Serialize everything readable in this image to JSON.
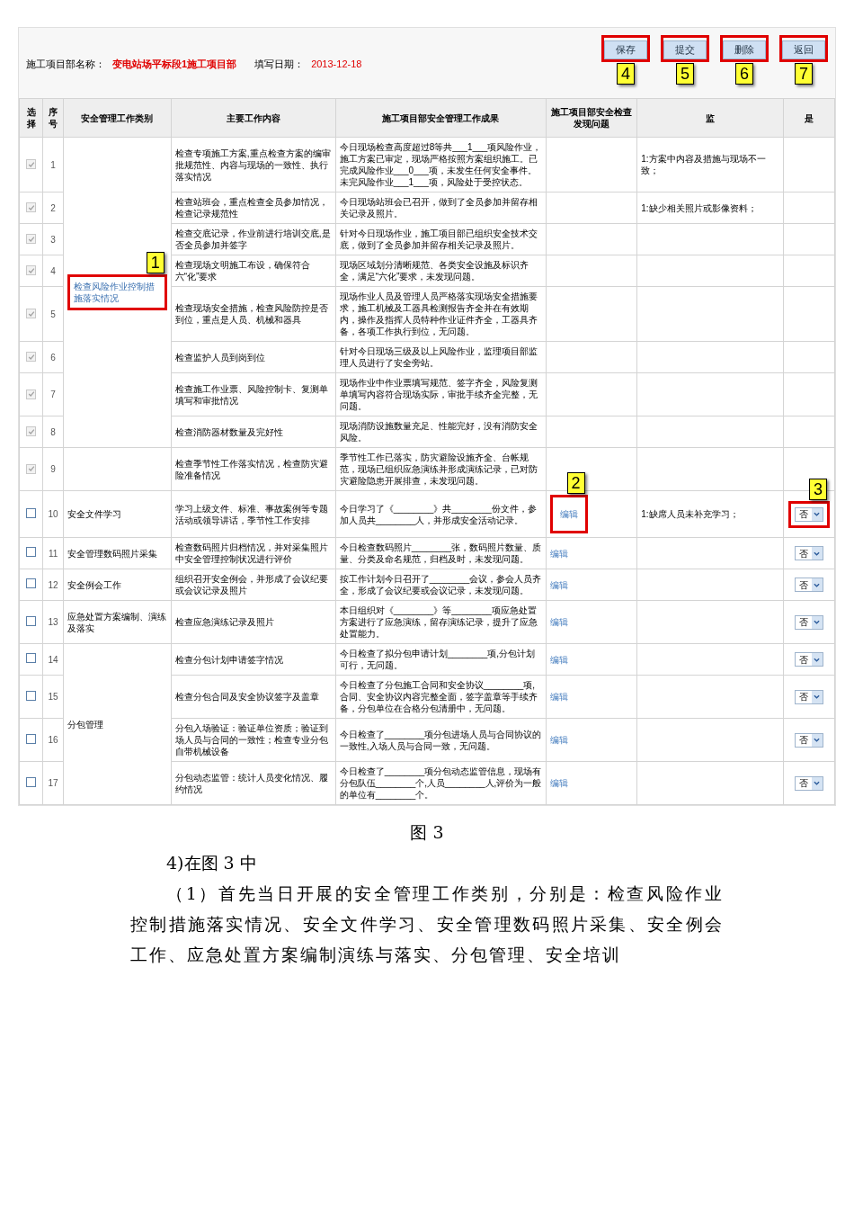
{
  "info": {
    "project_label": "施工项目部名称：",
    "project_value": "变电站场平标段1施工项目部",
    "date_label": "填写日期：",
    "date_value": "2013-12-18"
  },
  "buttons": [
    {
      "label": "保存",
      "callout": "4"
    },
    {
      "label": "提交",
      "callout": "5"
    },
    {
      "label": "删除",
      "callout": "6"
    },
    {
      "label": "返回",
      "callout": "7"
    }
  ],
  "table": {
    "columns": [
      "选择",
      "序号",
      "安全管理工作类别",
      "主要工作内容",
      "施工项目部安全管理工作成果",
      "施工项目部安全检查发现问题",
      "监",
      "是"
    ],
    "groups": [
      {
        "category": "检查风险作业控制措施落实情况",
        "link": true,
        "callout": "1",
        "rows": [
          {
            "num": "1",
            "checked": true,
            "disabled": true,
            "main": "检查专项施工方案,重点检查方案的编审批规范性、内容与现场的一致性、执行落实情况",
            "result": "今日现场检查高度超过8等共___1___项风险作业，施工方案已审定，现场严格按照方案组织施工。已完成风险作业___0___项，未发生任何安全事件。未完风险作业___1___项，风险处于受控状态。",
            "problem": "1:方案中内容及措施与现场不一致；"
          },
          {
            "num": "2",
            "checked": true,
            "disabled": true,
            "main": "检查站班会，重点检查全员参加情况，检查记录规范性",
            "result": "今日现场站班会已召开，做到了全员参加并留存相关记录及照片。",
            "problem": "1:缺少相关照片或影像资料；"
          },
          {
            "num": "3",
            "checked": true,
            "disabled": true,
            "main": "检查交底记录，作业前进行培训交底,是否全员参加并签字",
            "result": "针对今日现场作业，施工项目部已组织安全技术交底，做到了全员参加并留存相关记录及照片。"
          },
          {
            "num": "4",
            "checked": true,
            "disabled": true,
            "main": "检查现场文明施工布设，确保符合六“化”要求",
            "result": "现场区域划分清晰规范、各类安全设施及标识齐全，满足“六化”要求，未发现问题。"
          },
          {
            "num": "5",
            "checked": true,
            "disabled": true,
            "main": "检查现场安全措施，检查风险防控是否到位，重点是人员、机械和器具",
            "result": "现场作业人员及管理人员严格落实现场安全措施要求，施工机械及工器具检测报告齐全并在有效期内，操作及指挥人员特种作业证件齐全，工器具齐备，各项工作执行到位，无问题。"
          },
          {
            "num": "6",
            "checked": true,
            "disabled": true,
            "main": "检查监护人员到岗到位",
            "result": "针对今日现场三级及以上风险作业，监理项目部监理人员进行了安全旁站。"
          },
          {
            "num": "7",
            "checked": true,
            "disabled": true,
            "main": "检查施工作业票、风险控制卡、复测单填写和审批情况",
            "result": "现场作业中作业票填写规范、签字齐全，风险复测单填写内容符合现场实际，审批手续齐全完整，无问题。"
          },
          {
            "num": "8",
            "checked": true,
            "disabled": true,
            "main": "检查消防器材数量及完好性",
            "result": "现场消防设施数量充足、性能完好，没有消防安全风险。"
          }
        ]
      },
      {
        "rows": [
          {
            "num": "9",
            "checked": true,
            "disabled": true,
            "main": "检查季节性工作落实情况，检查防灾避险准备情况",
            "result": "季节性工作已落实，防灾避险设施齐全、台帐规范，现场已组织应急演练并形成演练记录，已对防灾避险隐患开展排查，未发现问题。"
          }
        ]
      },
      {
        "category": "安全文件学习",
        "link": false,
        "rows": [
          {
            "num": "10",
            "checked": false,
            "disabled": false,
            "main": "学习上级文件、标准、事故案例等专题活动或领导讲话，季节性工作安排",
            "result": "今日学习了《________》共________份文件，参加人员共________人，并形成安全活动记录。",
            "edit": {
              "label": "编辑",
              "callout": "2"
            },
            "problem": "1:缺席人员未补充学习；",
            "answer": {
              "value": "否",
              "callout": "3"
            }
          }
        ]
      },
      {
        "category": "安全管理数码照片采集",
        "link": false,
        "rows": [
          {
            "num": "11",
            "checked": false,
            "disabled": false,
            "main": "检查数码照片归档情况，并对采集照片中安全管理控制状况进行评价",
            "result": "今日检查数码照片________张，数码照片数量、质量、分类及命名规范，归档及时，未发现问题。",
            "edit": {
              "label": "编辑"
            },
            "answer": {
              "value": "否"
            }
          }
        ]
      },
      {
        "category": "安全例会工作",
        "link": false,
        "rows": [
          {
            "num": "12",
            "checked": false,
            "disabled": false,
            "main": "组织召开安全例会，并形成了会议纪要或会议记录及照片",
            "result": "按工作计划今日召开了________会议，参会人员齐全，形成了会议纪要或会议记录，未发现问题。",
            "edit": {
              "label": "编辑"
            },
            "answer": {
              "value": "否"
            }
          }
        ]
      },
      {
        "category": "应急处置方案编制、演练及落实",
        "link": false,
        "rows": [
          {
            "num": "13",
            "checked": false,
            "disabled": false,
            "main": "检查应急演练记录及照片",
            "result": "本日组织对《________》等________项应急处置方案进行了应急演练，留存演练记录，提升了应急处置能力。",
            "edit": {
              "label": "编辑"
            },
            "answer": {
              "value": "否"
            }
          }
        ]
      },
      {
        "category": "分包管理",
        "link": false,
        "rows": [
          {
            "num": "14",
            "checked": false,
            "disabled": false,
            "main": "检查分包计划申请签字情况",
            "result": "今日检查了拟分包申请计划________项,分包计划可行，无问题。",
            "edit": {
              "label": "编辑"
            },
            "answer": {
              "value": "否"
            }
          },
          {
            "num": "15",
            "checked": false,
            "disabled": false,
            "main": "检查分包合同及安全协议签字及盖章",
            "result": "今日检查了分包施工合同和安全协议________项,合同、安全协议内容完整全面，签字盖章等手续齐备，分包单位在合格分包清册中，无问题。",
            "edit": {
              "label": "编辑"
            },
            "answer": {
              "value": "否"
            }
          },
          {
            "num": "16",
            "checked": false,
            "disabled": false,
            "main": "分包入场验证：验证单位资质；验证到场人员与合同的一致性；检查专业分包自带机械设备",
            "result": "今日检查了________项分包进场人员与合同协议的一致性,入场人员与合同一致，无问题。",
            "edit": {
              "label": "编辑"
            },
            "answer": {
              "value": "否"
            }
          },
          {
            "num": "17",
            "checked": false,
            "disabled": false,
            "main": "分包动态监管：统计人员变化情况、履约情况",
            "result": "今日检查了________项分包动态监管信息，现场有分包队伍________个,人员________人,评价为一般的单位有________个。",
            "edit": {
              "label": "编辑"
            },
            "answer": {
              "value": "否"
            }
          }
        ]
      }
    ]
  },
  "caption": "图 3",
  "heading": "4)在图 3 中",
  "paragraph": "（1）首先当日开展的安全管理工作类别，分别是：检查风险作业控制措施落实情况、安全文件学习、安全管理数码照片采集、安全例会工作、应急处置方案编制演练与落实、分包管理、安全培训"
}
